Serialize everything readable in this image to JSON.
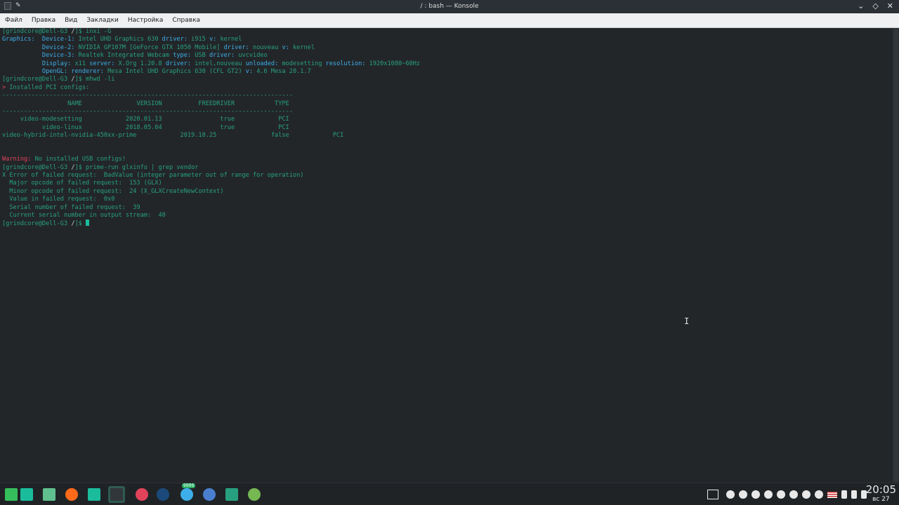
{
  "window": {
    "title": "/ : bash — Konsole",
    "controls": [
      "⌄",
      "◇",
      "✕"
    ]
  },
  "menu": [
    "Файл",
    "Правка",
    "Вид",
    "Закладки",
    "Настройка",
    "Справка"
  ],
  "terminal": {
    "lines": [
      [
        {
          "t": "[grindcore@Dell-G3 ",
          "c": "g"
        },
        {
          "t": "/",
          "c": "w"
        },
        {
          "t": "]$ inxi -G",
          "c": "g"
        }
      ],
      [
        {
          "t": "Graphics:  ",
          "c": "b"
        },
        {
          "t": "Device-1: ",
          "c": "b"
        },
        {
          "t": "Intel UHD Graphics 630 ",
          "c": "g"
        },
        {
          "t": "driver: ",
          "c": "b"
        },
        {
          "t": "i915 ",
          "c": "g"
        },
        {
          "t": "v: ",
          "c": "b"
        },
        {
          "t": "kernel",
          "c": "g"
        }
      ],
      [
        {
          "t": "           Device-2: ",
          "c": "b"
        },
        {
          "t": "NVIDIA GP107M [GeForce GTX 1050 Mobile] ",
          "c": "g"
        },
        {
          "t": "driver: ",
          "c": "b"
        },
        {
          "t": "nouveau ",
          "c": "g"
        },
        {
          "t": "v: ",
          "c": "b"
        },
        {
          "t": "kernel",
          "c": "g"
        }
      ],
      [
        {
          "t": "           Device-3: ",
          "c": "b"
        },
        {
          "t": "Realtek Integrated Webcam ",
          "c": "g"
        },
        {
          "t": "type: ",
          "c": "b"
        },
        {
          "t": "USB ",
          "c": "g"
        },
        {
          "t": "driver: ",
          "c": "b"
        },
        {
          "t": "uvcvideo",
          "c": "g"
        }
      ],
      [
        {
          "t": "           Display: ",
          "c": "b"
        },
        {
          "t": "x11 ",
          "c": "g"
        },
        {
          "t": "server: ",
          "c": "b"
        },
        {
          "t": "X.Org 1.20.8 ",
          "c": "g"
        },
        {
          "t": "driver: ",
          "c": "b"
        },
        {
          "t": "intel,nouveau ",
          "c": "g"
        },
        {
          "t": "unloaded: ",
          "c": "b"
        },
        {
          "t": "modesetting ",
          "c": "g"
        },
        {
          "t": "resolution: ",
          "c": "b"
        },
        {
          "t": "1920x1080~60Hz",
          "c": "g"
        }
      ],
      [
        {
          "t": "           OpenGL: ",
          "c": "b"
        },
        {
          "t": "renderer: ",
          "c": "b"
        },
        {
          "t": "Mesa Intel UHD Graphics 630 (CFL GT2) ",
          "c": "g"
        },
        {
          "t": "v: ",
          "c": "b"
        },
        {
          "t": "4.6 Mesa 20.1.7",
          "c": "g"
        }
      ],
      [
        {
          "t": "[grindcore@Dell-G3 ",
          "c": "g"
        },
        {
          "t": "/",
          "c": "w"
        },
        {
          "t": "]$ mhwd -li",
          "c": "g"
        }
      ],
      [
        {
          "t": "> ",
          "c": "r"
        },
        {
          "t": "Installed PCI configs:",
          "c": "g"
        }
      ],
      [
        {
          "t": "--------------------------------------------------------------------------------",
          "c": "g"
        }
      ],
      [
        {
          "t": "                  NAME               VERSION          FREEDRIVER           TYPE",
          "c": "g"
        }
      ],
      [
        {
          "t": "--------------------------------------------------------------------------------",
          "c": "g"
        }
      ],
      [
        {
          "t": "     video-modesetting            2020.01.13                true            PCI",
          "c": "g"
        }
      ],
      [
        {
          "t": "           video-linux            2018.05.04                true            PCI",
          "c": "g"
        }
      ],
      [
        {
          "t": "video-hybrid-intel-nvidia-450xx-prime            2019.10.25               false            PCI",
          "c": "g"
        }
      ],
      [],
      [],
      [
        {
          "t": "Warning: ",
          "c": "r"
        },
        {
          "t": "No installed USB configs!",
          "c": "g"
        }
      ],
      [
        {
          "t": "[grindcore@Dell-G3 ",
          "c": "g"
        },
        {
          "t": "/",
          "c": "w"
        },
        {
          "t": "]$ prime-run glxinfo | grep vendor",
          "c": "g"
        }
      ],
      [
        {
          "t": "X Error of failed request:  BadValue (integer parameter out of range for operation)",
          "c": "g"
        }
      ],
      [
        {
          "t": "  Major opcode of failed request:  153 (GLX)",
          "c": "g"
        }
      ],
      [
        {
          "t": "  Minor opcode of failed request:  24 (X_GLXCreateNewContext)",
          "c": "g"
        }
      ],
      [
        {
          "t": "  Value in failed request:  0x0",
          "c": "g"
        }
      ],
      [
        {
          "t": "  Serial number of failed request:  39",
          "c": "g"
        }
      ],
      [
        {
          "t": "  Current serial number in output stream:  40",
          "c": "g"
        }
      ],
      [
        {
          "t": "[grindcore@Dell-G3 ",
          "c": "g"
        },
        {
          "t": "/",
          "c": "w"
        },
        {
          "t": "]$ ",
          "c": "g"
        }
      ]
    ],
    "colors": {
      "green": "#27a07f",
      "blue": "#3daee9",
      "red": "#e0435a",
      "white": "#d0d0d0"
    }
  },
  "taskbar": {
    "apps": [
      {
        "name": "manjaro-menu-icon",
        "color": "#35bf5c"
      },
      {
        "name": "desktop-icon",
        "color": "#1abc9c"
      },
      {
        "name": "files-icon",
        "color": "#5fbf8f"
      },
      {
        "name": "firefox-icon",
        "color": "#ff6a1a"
      },
      {
        "name": "editor-icon",
        "color": "#1abc9c"
      },
      {
        "name": "konsole-icon",
        "color": "#31363b"
      },
      {
        "name": "vpn-icon",
        "color": "#e0435a"
      },
      {
        "name": "steam-icon",
        "color": "#1b4a7a"
      },
      {
        "name": "telegram-icon",
        "color": "#3daee9",
        "badge": "9999"
      },
      {
        "name": "chrome-icon",
        "color": "#4a7fd0"
      },
      {
        "name": "monitor-icon",
        "color": "#27a07f"
      },
      {
        "name": "download-icon",
        "color": "#76b852"
      }
    ],
    "tray_icons": [
      "display-icon",
      "pause-icon",
      "media-icon",
      "steam-tray-icon",
      "vpn-tray-icon",
      "clipboard-icon",
      "volume-icon",
      "battery-icon",
      "notes-icon",
      "flag-us-icon",
      "wifi-icon",
      "bluetooth-icon",
      "arrow-up-icon"
    ],
    "clock": {
      "time": "20:05",
      "date": "вс 27"
    }
  }
}
